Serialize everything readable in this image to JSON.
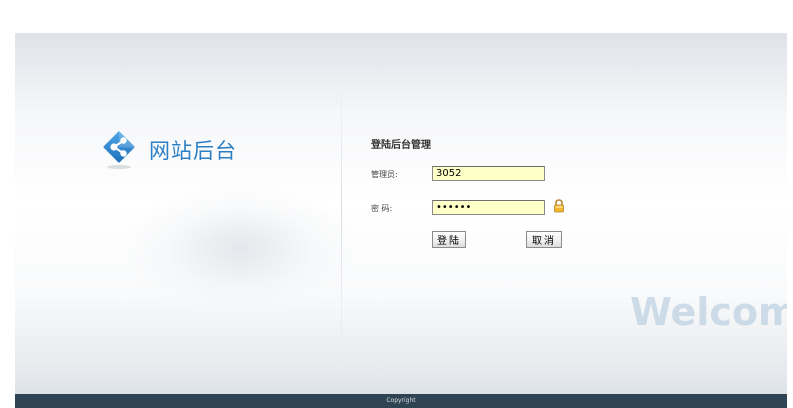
{
  "logo": {
    "icon": "share-nodes-icon",
    "text": "网站后台",
    "color": "#2d7fc3"
  },
  "login_form": {
    "title": "登陆后台管理",
    "username_label": "管理员:",
    "username_value": "3052",
    "password_label": "密 码:",
    "password_value": "••••••",
    "lock_icon": "lock-icon",
    "login_button": "登陆",
    "cancel_button": "取消",
    "field_color": "#ffffc8"
  },
  "watermark": "Welcome",
  "footer": {
    "text": "Copyright",
    "color": "#2f4453"
  }
}
